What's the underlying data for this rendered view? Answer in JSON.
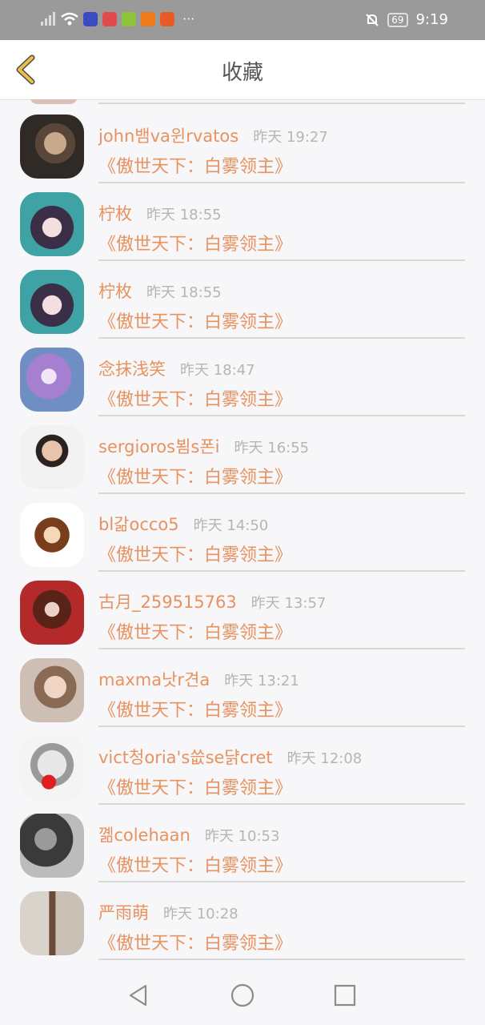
{
  "status_bar": {
    "time": "9:19",
    "battery": "69",
    "more": "···"
  },
  "header": {
    "title": "收藏",
    "back_icon": "chevron-left-icon",
    "accent": "#e8c04a"
  },
  "colors": {
    "name": "#e7925f",
    "time": "#b5b5b5",
    "divider": "#d8d8d8"
  },
  "items": [
    {
      "name": "john뱀va윈rvatos",
      "time": "昨天 19:27",
      "book": "《傲世天下：白雾领主》"
    },
    {
      "name": "柠枚",
      "time": "昨天 18:55",
      "book": "《傲世天下：白雾领主》"
    },
    {
      "name": "柠枚",
      "time": "昨天 18:55",
      "book": "《傲世天下：白雾领主》"
    },
    {
      "name": "念抹浅笑",
      "time": "昨天 18:47",
      "book": "《傲世天下：白雾领主》"
    },
    {
      "name": "sergioros뵘s폰i",
      "time": "昨天 16:55",
      "book": "《傲世天下：白雾领主》"
    },
    {
      "name": "bl갊occo5",
      "time": "昨天 14:50",
      "book": "《傲世天下：白雾领主》"
    },
    {
      "name": "古月_259515763",
      "time": "昨天 13:57",
      "book": "《傲世天下：白雾领主》"
    },
    {
      "name": "maxma낫r견a",
      "time": "昨天 13:21",
      "book": "《傲世天下：白雾领主》"
    },
    {
      "name": "vict청oria's씂se댥cret",
      "time": "昨天 12:08",
      "book": "《傲世天下：白雾领主》"
    },
    {
      "name": "꼚colehaan",
      "time": "昨天 10:53",
      "book": "《傲世天下：白雾领主》"
    },
    {
      "name": "严雨萌",
      "time": "昨天 10:28",
      "book": "《傲世天下：白雾领主》"
    }
  ]
}
